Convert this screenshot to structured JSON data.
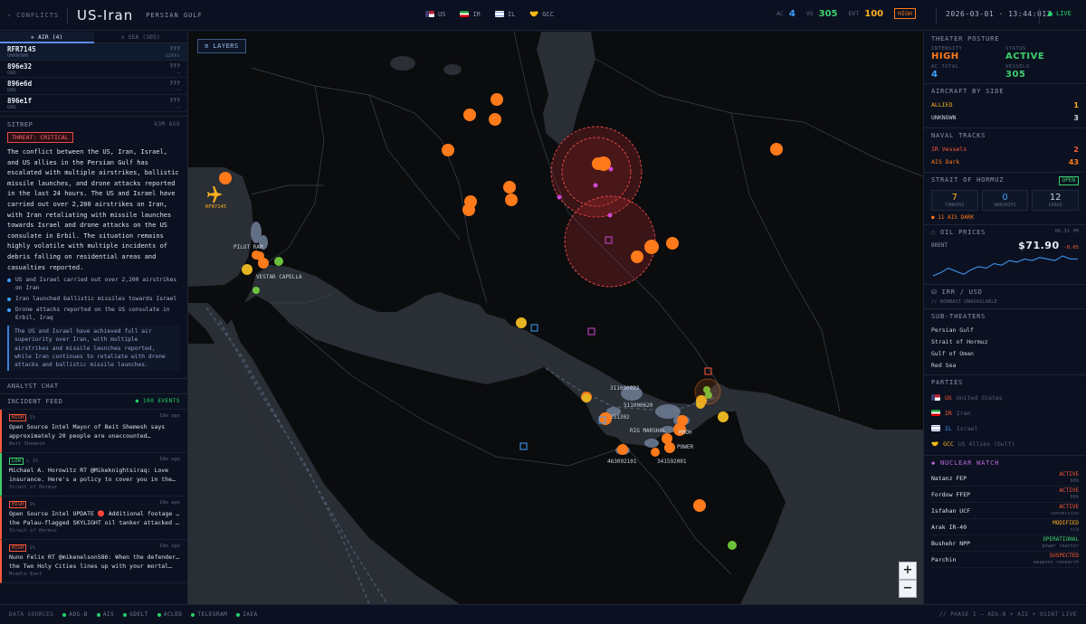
{
  "header": {
    "back_label": "CONFLICTS",
    "title": "US-Iran",
    "subtitle": "PERSIAN GULF",
    "parties": [
      {
        "code": "US",
        "color": "#3b6fd6"
      },
      {
        "code": "IR",
        "color": "#1f9d55"
      },
      {
        "code": "IL",
        "color": "#4a7fe0"
      },
      {
        "code": "GCC",
        "color": "#e6b422"
      }
    ],
    "ac_label": "AC",
    "ac_value": "4",
    "vs_label": "VS",
    "vs_value": "305",
    "evt_label": "EVT",
    "evt_value": "100",
    "level": "HIGH",
    "clock": "2026-03-01 · 13:44:01Z",
    "live": "LIVE"
  },
  "tracks": {
    "tab_air": "✈ AIR (4)",
    "tab_sea": "⚓ SEA (305)",
    "items": [
      {
        "callsign": "RFR7145",
        "status": "UNKNOWN",
        "alt": "???",
        "speed": "220kt"
      },
      {
        "callsign": "896e32",
        "status": "GND",
        "alt": "???",
        "speed": "—"
      },
      {
        "callsign": "896e6d",
        "status": "GND",
        "alt": "???",
        "speed": "—"
      },
      {
        "callsign": "896e1f",
        "status": "GND",
        "alt": "???",
        "speed": "—"
      }
    ]
  },
  "sitrep": {
    "label": "SITREP",
    "ago": "63M AGO",
    "threat": "THREAT: CRITICAL",
    "text": "The conflict between the US, Iran, Israel, and US allies in the Persian Gulf has escalated with multiple airstrikes, ballistic missile launches, and drone attacks reported in the last 24 hours. The US and Israel have carried out over 2,200 airstrikes on Iran, with Iran retaliating with missile launches towards Israel and drone attacks on the US consulate in Erbil. The situation remains highly volatile with multiple incidents of debris falling on residential areas and casualties reported.",
    "bullets": [
      "US and Israel carried out over 2,200 airstrikes on Iran",
      "Iran launched ballistic missiles towards Israel",
      "Drone attacks reported on the US consulate in Erbil, Iraq"
    ],
    "quote": "The US and Israel have achieved full air superiority over Iran, with multiple airstrikes and missile launches reported, while Iran continues to retaliate with drone attacks and ballistic missile launches."
  },
  "analyst_chat": "ANALYST CHAT",
  "incident_feed": {
    "label": "INCIDENT FEED",
    "count": "● 100 EVENTS",
    "items": [
      {
        "sev": "HIGH",
        "sev_color": "#ff5a3a",
        "pct": "1%",
        "ago": "10m ago",
        "line1": "Open Source Intel Mayor of Beit Shemesh says",
        "line2": "approximately 20 people are unaccounted…",
        "loc": "Beit Shemesh"
      },
      {
        "sev": "LOW",
        "sev_color": "#3ecf6e",
        "pct": "⚓ 1%",
        "ago": "10m ago",
        "line1": "Michael A. Horowitz RT @Mikeknightsiraq: Love",
        "line2": "insurance. Here's a policy to cover you in the…",
        "loc": "Strait of Hormuz"
      },
      {
        "sev": "HIGH",
        "sev_color": "#ff5a3a",
        "pct": "1%",
        "ago": "10m ago",
        "line1": "Open Source Intel UPDATE 🔴 Additional footage of",
        "line2": "the Palau-flagged SKYLIGHT oil tanker attacked i…",
        "loc": "Strait of Hormuz"
      },
      {
        "sev": "HIGH",
        "sev_color": "#ff5a3a",
        "pct": "1%",
        "ago": "10m ago",
        "line1": "Nuno Felix RT @mikenelson586: When the defender of",
        "line2": "the Two Holy Cities lines up with your mortal…",
        "loc": "Middle East"
      }
    ]
  },
  "map": {
    "layers_label": "≡ LAYERS",
    "zoom_in": "+",
    "zoom_out": "−",
    "labels": {
      "aircraft": "RFR7145",
      "port1": "PILOT RAM",
      "port2": "VESTAR CAPELLA",
      "vessel1": "311000922",
      "vessel2": "511000620",
      "vessel3": "351302",
      "vessel4": "RIG MARSHAL",
      "vessel5": "MMOH",
      "vessel6": "POWER",
      "vessel7": "463092101",
      "vessel8": "341592001"
    }
  },
  "posture": {
    "label": "THEATER POSTURE",
    "intensity_label": "INTENSITY",
    "intensity": "HIGH",
    "status_label": "STATUS",
    "status": "ACTIVE",
    "ac_label": "AC TOTAL",
    "ac": "4",
    "vessels_label": "VESSELS",
    "vessels": "305"
  },
  "aircraft_by_side": {
    "label": "AIRCRAFT BY SIDE",
    "rows": [
      {
        "name": "ALLIED",
        "value": "1",
        "color": "#ffb020"
      },
      {
        "name": "UNKNOWN",
        "value": "3",
        "color": "#c8d2e0"
      }
    ]
  },
  "naval": {
    "label": "NAVAL TRACKS",
    "rows": [
      {
        "name": "IR Vessels",
        "value": "2",
        "color": "#ff5a3a"
      },
      {
        "name": "AIS Dark",
        "value": "43",
        "color": "#ff7a1a"
      }
    ]
  },
  "hormuz": {
    "label": "STRAIT OF HORMUZ",
    "status": "OPEN",
    "stats": [
      {
        "n": "7",
        "l": "TANKERS",
        "color": "#ffb020"
      },
      {
        "n": "0",
        "l": "WARSHIPS",
        "color": "#3fa0ff"
      },
      {
        "n": "12",
        "l": "CARGO",
        "color": "#c8d2e0"
      }
    ],
    "dark": "● 11 AIS DARK"
  },
  "oil": {
    "label": "OIL PRICES",
    "time": "06:31 PM",
    "name": "BRENT",
    "price": "$71.90",
    "change": "-0.65",
    "spark": [
      70.8,
      71.0,
      71.3,
      71.1,
      70.9,
      71.2,
      71.4,
      71.3,
      71.6,
      71.5,
      71.8,
      71.7,
      71.9,
      71.8,
      72.0,
      71.9,
      71.8,
      72.1,
      71.9,
      71.9
    ]
  },
  "fx": {
    "label": "⛁ IRR / USD",
    "note": "// BONBAST UNAVAILABLE"
  },
  "subtheaters": {
    "label": "SUB-THEATERS",
    "items": [
      "Persian Gulf",
      "Strait of Hormuz",
      "Gulf of Oman",
      "Red Sea"
    ]
  },
  "parties": {
    "label": "PARTIES",
    "items": [
      {
        "code": "US",
        "name": "United States",
        "color": "#ff5a3a"
      },
      {
        "code": "IR",
        "name": "Iran",
        "color": "#ff5a3a"
      },
      {
        "code": "IL",
        "name": "Israel",
        "color": "#3fa0ff"
      },
      {
        "code": "GCC",
        "name": "US Allies (Gulf)",
        "color": "#ffb020"
      }
    ]
  },
  "nuclear": {
    "label": "◆ NUCLEAR WATCH",
    "items": [
      {
        "name": "Natanz FEP",
        "status": "ACTIVE",
        "detail": "60%",
        "color": "#ff5a3a"
      },
      {
        "name": "Fordow FFEP",
        "status": "ACTIVE",
        "detail": "60%",
        "color": "#ff5a3a"
      },
      {
        "name": "Isfahan UCF",
        "status": "ACTIVE",
        "detail": "conversion",
        "color": "#ff5a3a"
      },
      {
        "name": "Arak IR-40",
        "status": "MODIFIED",
        "detail": "n/a",
        "color": "#ffb020"
      },
      {
        "name": "Bushehr NPP",
        "status": "OPERATIONAL",
        "detail": "power reactor",
        "color": "#3ecf6e"
      },
      {
        "name": "Parchin",
        "status": "SUSPECTED",
        "detail": "weapons research",
        "color": "#ff5a3a"
      }
    ]
  },
  "footer": {
    "label": "DATA SOURCES",
    "sources": [
      "ADS-B",
      "AIS",
      "GDELT",
      "ACLED",
      "TELEGRAM",
      "IAEA"
    ],
    "right": "// PHASE 1 — ADS-B + AIS + OSINT LIVE"
  }
}
